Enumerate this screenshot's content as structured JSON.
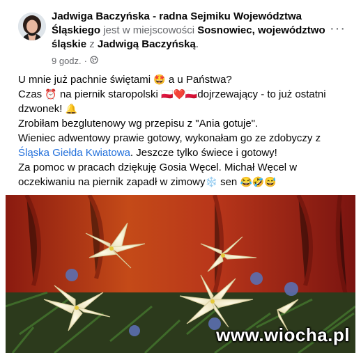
{
  "post": {
    "author": "Jadwiga Baczyńska - radna Sejmiku Województwa Śląskiego",
    "location_prefix": "jest w miejscowości",
    "location": "Sosnowiec, województwo śląskie",
    "with_prefix": "z",
    "with_person": "Jadwigą Baczyńską",
    "period": ".",
    "time": "9 godz.",
    "separator": "·",
    "more_label": "···"
  },
  "content": {
    "line1": "U mnie już pachnie świętami",
    "line1_emoji": "🤩",
    "line1_end": "a u Państwa?",
    "line2_a": "Czas",
    "line2_emoji1": "⏰",
    "line2_b": "na piernik staropolski",
    "line2_flags": "🇵🇱❤️🇵🇱",
    "line2_c": "dojrzewający - to już ostatni dzwonek!",
    "line2_emoji2": "🔔",
    "line3": "Zrobiłam bezglutenowy wg przepisu z \"Ania gotuje\".",
    "line4_a": "Wieniec adwentowy prawie gotowy, wykonałam go ze zdobyczy z",
    "line4_link": "Śląska Giełda Kwiatowa",
    "line4_b": ". Jeszcze tylko świece i gotowy!",
    "line5_a": "Za pomoc w pracach dziękuję Gosia Węcel. Michał Węcel w oczekiwaniu na piernik zapadł w zimowy",
    "line5_emoji1": "❄️",
    "line5_b": "sen",
    "line5_emoji2": "😂🤣😅"
  },
  "photo": {
    "watermark": "www.wiocha.pl"
  },
  "colors": {
    "link": "#216fdb",
    "muted": "#65676b",
    "text": "#050505"
  },
  "icons": {
    "globe": "globe-icon",
    "more": "more-options-icon"
  }
}
